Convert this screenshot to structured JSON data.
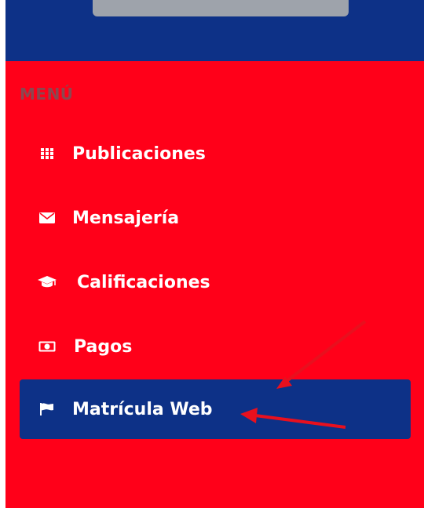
{
  "sidebar": {
    "heading": "MENÚ",
    "items": [
      {
        "label": "Publicaciones",
        "icon": "grid-icon",
        "active": false
      },
      {
        "label": "Mensajería",
        "icon": "envelope-icon",
        "active": false
      },
      {
        "label": "Calificaciones",
        "icon": "graduation-cap-icon",
        "active": false
      },
      {
        "label": "Pagos",
        "icon": "money-icon",
        "active": false
      },
      {
        "label": "Matrícula Web",
        "icon": "flag-icon",
        "active": true
      }
    ]
  },
  "colors": {
    "header_bg": "#0d3187",
    "sidebar_bg": "#ff0019",
    "active_item_bg": "#0d3187",
    "heading_text": "#8c4750",
    "annotation_arrow": "#e8101e"
  }
}
